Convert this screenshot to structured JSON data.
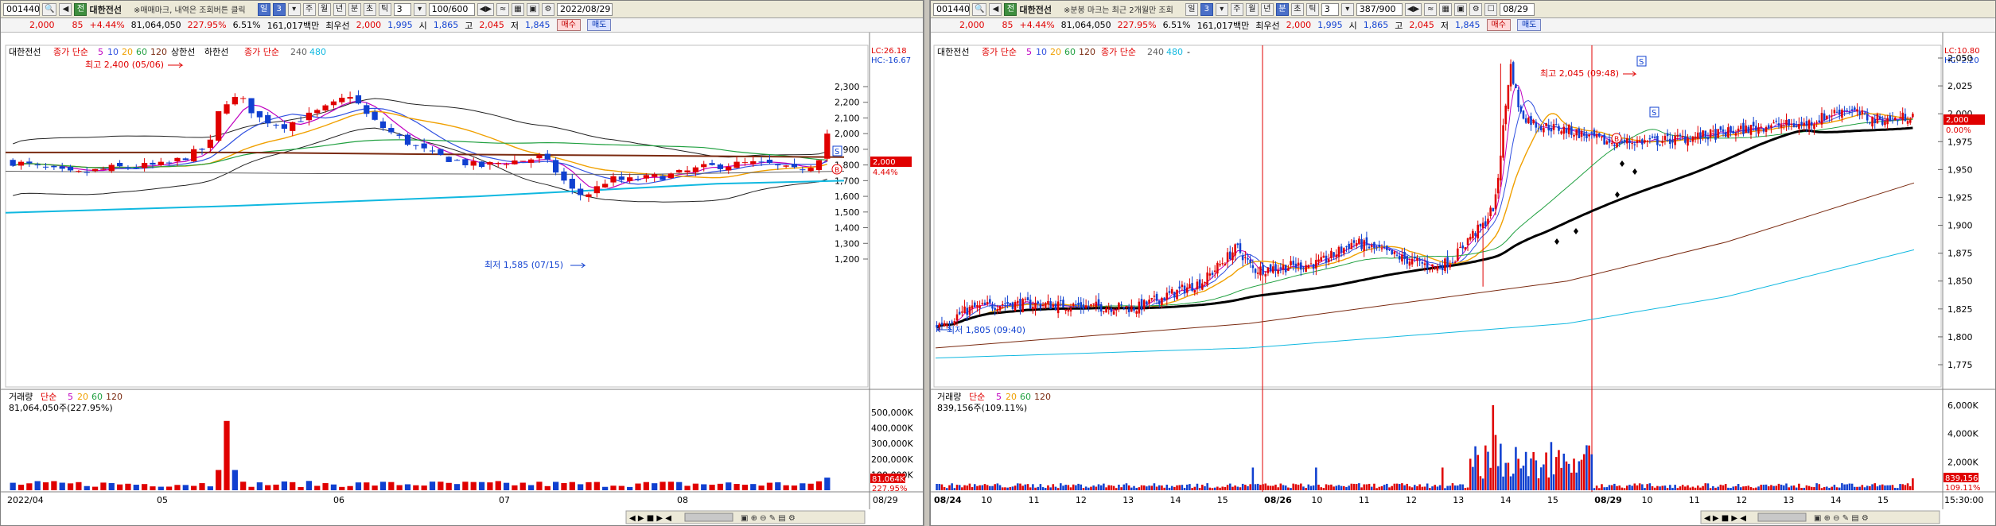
{
  "left": {
    "toolbar": {
      "code": "001440",
      "stock_badge": "전",
      "stock_name": "대한전선",
      "memo": "※매매마크, 내역은 조회버튼 클릭",
      "period_day": "일",
      "period_num": "3",
      "periods": [
        "주",
        "월",
        "년",
        "분",
        "초",
        "틱"
      ],
      "tick_num": "3",
      "count": "100/600",
      "date": "2022/08/29"
    },
    "quote": {
      "price": "2,000",
      "change": "85",
      "change_pct": "+4.44%",
      "volume": "81,064,050",
      "vol_ratio": "227.95%",
      "turnover_rate": "6.51%",
      "amount": "161,017백만",
      "best_ask_label": "최우선",
      "best_ask": "2,000",
      "best_bid": "1,995",
      "open_label": "시",
      "open": "1,865",
      "high_label": "고",
      "high": "2,045",
      "low_label": "저",
      "low": "1,845",
      "buy": "매수",
      "sell": "매도"
    },
    "legend": {
      "name": "대한전선",
      "ma_label": "종가 단순",
      "ma_periods": [
        "5",
        "10",
        "20",
        "60",
        "120"
      ],
      "upper_limit": "상한선",
      "lower_limit": "하한선",
      "ma_label2": "종가 단순",
      "ma_long": [
        "240",
        "480"
      ]
    },
    "price_axis": [
      "2,300",
      "2,200",
      "2,100",
      "2,000",
      "1,900",
      "1,800",
      "1,700",
      "1,600",
      "1,500",
      "1,400",
      "1,300",
      "1,200"
    ],
    "lc_label": "LC:26.18",
    "hc_label": "HC:-16.67",
    "current_tag": "2,000",
    "current_pct": "4.44%",
    "high_annotation": "최고 2,400 (05/06)",
    "low_annotation": "최저 1,585 (07/15)",
    "marker_s": "S",
    "marker_b": "B",
    "volume_legend": {
      "label": "거래량",
      "type": "단순",
      "periods": [
        "5",
        "20",
        "60",
        "120"
      ],
      "value": "81,064,050주(227.95%)"
    },
    "volume_axis": [
      "500,000K",
      "400,000K",
      "300,000K",
      "200,000K",
      "100,000K"
    ],
    "volume_tag": "81,064K",
    "volume_tag_pct": "227.95%",
    "x_labels": [
      "2022/04",
      "05",
      "06",
      "07",
      "08"
    ],
    "x_end_label": "08/29"
  },
  "right": {
    "toolbar": {
      "code": "001440",
      "stock_badge": "전",
      "stock_name": "대한전선",
      "memo": "※분봉 마크는 최근 2개월만 조회",
      "period_day": "일",
      "period_num": "3",
      "periods": [
        "주",
        "월",
        "년",
        "분",
        "초",
        "틱"
      ],
      "tick_num": "3",
      "count": "387/900",
      "date": "08/29"
    },
    "quote": {
      "price": "2,000",
      "change": "85",
      "change_pct": "+4.44%",
      "volume": "81,064,050",
      "vol_ratio": "227.95%",
      "turnover_rate": "6.51%",
      "amount": "161,017백만",
      "best_ask_label": "최우선",
      "best_ask": "2,000",
      "best_bid": "1,995",
      "open_label": "시",
      "open": "1,865",
      "high_label": "고",
      "high": "2,045",
      "low_label": "저",
      "low": "1,845",
      "buy": "매수",
      "sell": "매도"
    },
    "legend": {
      "name": "대한전선",
      "ma_label": "종가 단순",
      "ma_periods": [
        "5",
        "10",
        "20",
        "60",
        "120"
      ],
      "ma_label2": "종가 단순",
      "ma_long": [
        "240",
        "480"
      ],
      "trailing": "-"
    },
    "price_axis": [
      "2,050",
      "2,025",
      "2,000",
      "1,975",
      "1,950",
      "1,925",
      "1,900",
      "1,875",
      "1,850",
      "1,825",
      "1,800",
      "1,775"
    ],
    "lc_label": "LC:10.80",
    "hc_label": "HC:-2.20",
    "current_tag": "2,000",
    "current_pct": "0.00%",
    "high_annotation": "최고 2,045 (09:48)",
    "low_annotation": "최저 1,805 (09:40)",
    "marker_s": "S",
    "marker_b": "B",
    "volume_legend": {
      "label": "거래량",
      "type": "단순",
      "periods": [
        "5",
        "20",
        "60",
        "120"
      ],
      "value": "839,156주(109.11%)"
    },
    "volume_axis": [
      "6,000K",
      "4,000K",
      "2,000K"
    ],
    "volume_tag": "839,156",
    "volume_tag_pct": "109.11%",
    "x_labels": [
      "08/24",
      "10",
      "11",
      "12",
      "13",
      "14",
      "15",
      "08/26",
      "10",
      "11",
      "12",
      "13",
      "14",
      "15",
      "08/29",
      "10",
      "11",
      "12",
      "13",
      "14",
      "15"
    ],
    "x_end_label": "15:30:00"
  },
  "colors": {
    "up": "#e00000",
    "down": "#1040d0",
    "ma5": "#c000c0",
    "ma10": "#3050e0",
    "ma20": "#f0a000",
    "ma60": "#20a040",
    "ma120": "#7a2a10",
    "ma240": "#606060",
    "ma480": "#10b8e0",
    "bollinger": "#222222"
  },
  "chart_data": [
    {
      "type": "candlestick",
      "title": "대한전선 일봉",
      "x_range": [
        "2022/04",
        "2022/08/29"
      ],
      "ylim": [
        1200,
        2350
      ],
      "annotations": [
        {
          "label": "최고",
          "value": 2400,
          "date": "05/06"
        },
        {
          "label": "최저",
          "value": 1585,
          "date": "07/15"
        }
      ],
      "last_close": 2000,
      "volume_ylim": [
        0,
        500000000
      ],
      "last_volume": 81064050
    },
    {
      "type": "candlestick",
      "title": "대한전선 3분봉",
      "x_range": [
        "08/24",
        "08/29 15:30:00"
      ],
      "ylim": [
        1775,
        2050
      ],
      "annotations": [
        {
          "label": "최고",
          "value": 2045,
          "time": "09:48"
        },
        {
          "label": "최저",
          "value": 1805,
          "time": "09:40"
        }
      ],
      "last_close": 2000,
      "volume_ylim": [
        0,
        6000000
      ],
      "last_volume": 839156
    }
  ]
}
